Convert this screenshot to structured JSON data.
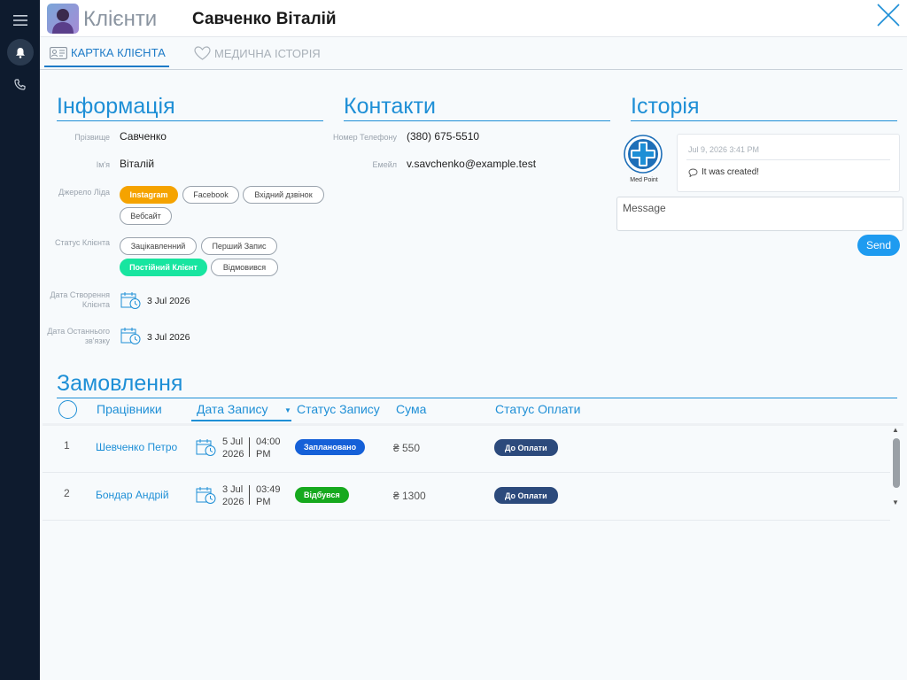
{
  "header": {
    "page_title": "Клієнти",
    "client_name": "Савченко Віталій"
  },
  "tabs": [
    {
      "label": "КАРТКА КЛІЄНТА",
      "active": true
    },
    {
      "label": "МЕДИЧНА ІСТОРІЯ",
      "active": false
    }
  ],
  "info": {
    "title": "Інформація",
    "surname_label": "Прізвище",
    "surname": "Савченко",
    "name_label": "Ім'я",
    "name": "Віталій",
    "lead_source_label": "Джерело Ліда",
    "lead_sources": [
      {
        "label": "Instagram",
        "selected": true
      },
      {
        "label": "Facebook",
        "selected": false
      },
      {
        "label": "Вхідний дзвінок",
        "selected": false
      },
      {
        "label": "Вебсайт",
        "selected": false
      }
    ],
    "client_status_label": "Статус Клієнта",
    "client_statuses": [
      {
        "label": "Зацікавленний",
        "selected": false
      },
      {
        "label": "Перший Запис",
        "selected": false
      },
      {
        "label": "Постійний Клієнт",
        "selected": true
      },
      {
        "label": "Відмовився",
        "selected": false
      }
    ],
    "created_label_1": "Дата Створення",
    "created_label_2": "Клієнта",
    "created_date": "3 Jul 2026",
    "last_contact_label_1": "Дата Останнього",
    "last_contact_label_2": "зв'язку",
    "last_contact_date": "3 Jul 2026"
  },
  "contacts": {
    "title": "Контакти",
    "phone_label": "Номер Телефону",
    "phone": "(380) 675-5510",
    "email_label": "Емейл",
    "email": "v.savchenko@example.test"
  },
  "history": {
    "title": "Історія",
    "logo_caption": "Med Point",
    "entry_date": "Jul 9, 2026 3:41 PM",
    "entry_text": "It was created!",
    "message_placeholder": "Message",
    "send_label": "Send"
  },
  "orders": {
    "title": "Замовлення",
    "columns": [
      "Працівники",
      "Дата Запису",
      "Статус Запису",
      "Сума",
      "Статус Оплати"
    ],
    "rows": [
      {
        "num": "1",
        "worker": "Шевченко Петро",
        "date_day": "5 Jul",
        "date_year": "2026",
        "time": "04:00",
        "ampm": "PM",
        "status": "Заплановано",
        "status_color": "#1560d8",
        "sum": "₴ 550",
        "payment": "До Оплати"
      },
      {
        "num": "2",
        "worker": "Бондар Андрій",
        "date_day": "3 Jul",
        "date_year": "2026",
        "time": "03:49",
        "ampm": "PM",
        "status": "Відбувся",
        "status_color": "#16a91e",
        "sum": "₴ 1300",
        "payment": "До Оплати"
      }
    ]
  },
  "colors": {
    "accent": "#1e8fd6",
    "rail": "#0e1b2e",
    "instagram_selected": "#f5a300",
    "status_selected": "#18e5a0",
    "payment_badge": "#2c4a7c"
  }
}
